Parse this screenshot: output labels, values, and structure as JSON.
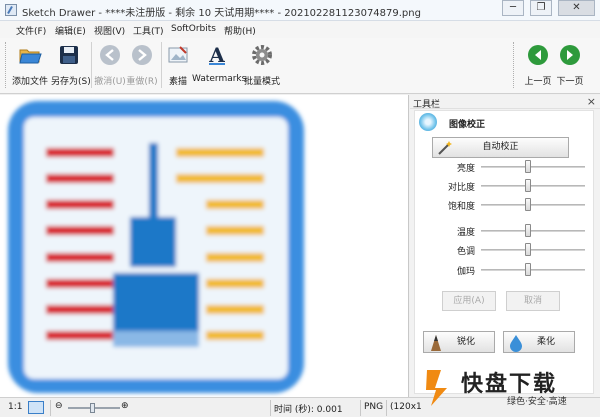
{
  "window": {
    "title": "Sketch Drawer - ****未注册版 - 剩余 10 天试用期**** - 20210228112307487​9.png",
    "minimize": "─",
    "restore": "❐",
    "close": "✕"
  },
  "menu": [
    "文件(F)",
    "编辑(E)",
    "视图(V)",
    "工具(T)",
    "SoftOrbits",
    "帮助(H)"
  ],
  "toolbar": {
    "add_file": "添加文件",
    "save_as": "另存为(S)",
    "undo": "撤消(U)",
    "redo": "重做(R)",
    "sketch": "素描",
    "watermarks": "Watermarks",
    "batch": "批量模式",
    "prev": "上一页",
    "next": "下一页"
  },
  "panel": {
    "title": "工具栏",
    "close": "×",
    "section_title": "图像校正",
    "auto_button": "自动校正",
    "sliders": [
      {
        "label": "亮度",
        "value": 0.5
      },
      {
        "label": "对比度",
        "value": 0.5
      },
      {
        "label": "饱和度",
        "value": 0.5
      },
      {
        "label": "温度",
        "value": 0.5
      },
      {
        "label": "色调",
        "value": 0.5
      },
      {
        "label": "伽玛",
        "value": 0.5
      }
    ],
    "apply": "应用(A)",
    "cancel": "取消",
    "sharpen": "锐化",
    "soften": "柔化"
  },
  "status": {
    "zoom_ratio": "1:1",
    "time": "时间 (秒): 0.001",
    "format": "PNG",
    "size": "(120x1"
  },
  "watermark": {
    "brand": "快盘下载",
    "slogan": "绿色·安全·高速"
  },
  "colors": {
    "accent_green": "#2e9a3c",
    "icon_blue": "#3b8ee0",
    "icon_red": "#d8232a",
    "icon_yellow": "#f1b92c",
    "watermark_orange": "#f08a12"
  }
}
